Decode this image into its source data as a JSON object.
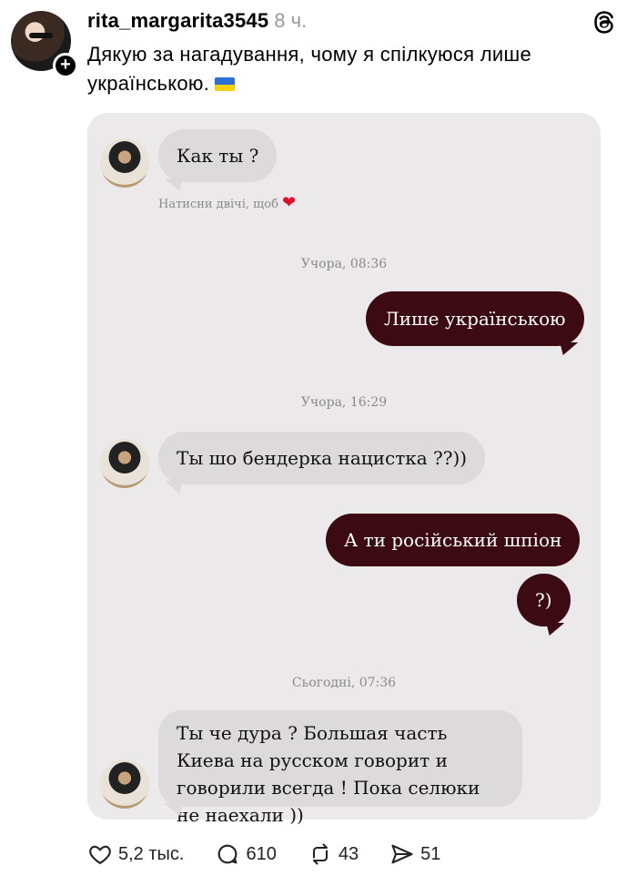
{
  "post": {
    "username": "rita_margarita3545",
    "time_ago": "8 ч.",
    "text": "Дякую за нагадування, чому я спілкуюся лише українською.",
    "flag_icon": "ukraine-flag-icon"
  },
  "screenshot": {
    "messages": [
      {
        "side": "in",
        "text": "Как ты ?"
      },
      {
        "hint": "Натисни двічі, щоб",
        "heart": "❤"
      },
      {
        "timestamp": "Учора, 08:36"
      },
      {
        "side": "out",
        "text": "Лише українською"
      },
      {
        "timestamp": "Учора, 16:29"
      },
      {
        "side": "in",
        "text": "Ты шо бендерка нацистка ??))"
      },
      {
        "side": "out",
        "text": "А ти російський шпіон"
      },
      {
        "side": "out",
        "text": "?)"
      },
      {
        "timestamp": "Сьогодні, 07:36"
      },
      {
        "side": "in",
        "text": "Ты че дура ? Большая часть Киева на русском говорит и говорили всегда ! Пока селюки не наехали ))"
      }
    ]
  },
  "actions": {
    "likes": "5,2 тыс.",
    "comments": "610",
    "reposts": "43",
    "shares": "51"
  },
  "colors": {
    "outgoing_bubble": "#3b0a12",
    "incoming_bubble": "#dcdadb",
    "screenshot_bg": "#ebe9ea"
  }
}
